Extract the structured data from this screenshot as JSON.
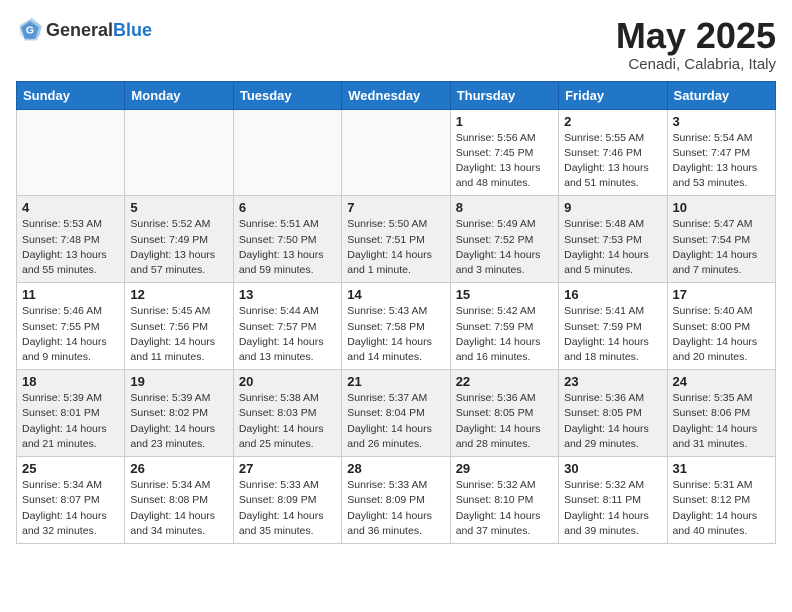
{
  "header": {
    "logo_general": "General",
    "logo_blue": "Blue",
    "month_title": "May 2025",
    "subtitle": "Cenadi, Calabria, Italy"
  },
  "weekdays": [
    "Sunday",
    "Monday",
    "Tuesday",
    "Wednesday",
    "Thursday",
    "Friday",
    "Saturday"
  ],
  "weeks": [
    [
      {
        "day": "",
        "info": ""
      },
      {
        "day": "",
        "info": ""
      },
      {
        "day": "",
        "info": ""
      },
      {
        "day": "",
        "info": ""
      },
      {
        "day": "1",
        "info": "Sunrise: 5:56 AM\nSunset: 7:45 PM\nDaylight: 13 hours\nand 48 minutes."
      },
      {
        "day": "2",
        "info": "Sunrise: 5:55 AM\nSunset: 7:46 PM\nDaylight: 13 hours\nand 51 minutes."
      },
      {
        "day": "3",
        "info": "Sunrise: 5:54 AM\nSunset: 7:47 PM\nDaylight: 13 hours\nand 53 minutes."
      }
    ],
    [
      {
        "day": "4",
        "info": "Sunrise: 5:53 AM\nSunset: 7:48 PM\nDaylight: 13 hours\nand 55 minutes."
      },
      {
        "day": "5",
        "info": "Sunrise: 5:52 AM\nSunset: 7:49 PM\nDaylight: 13 hours\nand 57 minutes."
      },
      {
        "day": "6",
        "info": "Sunrise: 5:51 AM\nSunset: 7:50 PM\nDaylight: 13 hours\nand 59 minutes."
      },
      {
        "day": "7",
        "info": "Sunrise: 5:50 AM\nSunset: 7:51 PM\nDaylight: 14 hours\nand 1 minute."
      },
      {
        "day": "8",
        "info": "Sunrise: 5:49 AM\nSunset: 7:52 PM\nDaylight: 14 hours\nand 3 minutes."
      },
      {
        "day": "9",
        "info": "Sunrise: 5:48 AM\nSunset: 7:53 PM\nDaylight: 14 hours\nand 5 minutes."
      },
      {
        "day": "10",
        "info": "Sunrise: 5:47 AM\nSunset: 7:54 PM\nDaylight: 14 hours\nand 7 minutes."
      }
    ],
    [
      {
        "day": "11",
        "info": "Sunrise: 5:46 AM\nSunset: 7:55 PM\nDaylight: 14 hours\nand 9 minutes."
      },
      {
        "day": "12",
        "info": "Sunrise: 5:45 AM\nSunset: 7:56 PM\nDaylight: 14 hours\nand 11 minutes."
      },
      {
        "day": "13",
        "info": "Sunrise: 5:44 AM\nSunset: 7:57 PM\nDaylight: 14 hours\nand 13 minutes."
      },
      {
        "day": "14",
        "info": "Sunrise: 5:43 AM\nSunset: 7:58 PM\nDaylight: 14 hours\nand 14 minutes."
      },
      {
        "day": "15",
        "info": "Sunrise: 5:42 AM\nSunset: 7:59 PM\nDaylight: 14 hours\nand 16 minutes."
      },
      {
        "day": "16",
        "info": "Sunrise: 5:41 AM\nSunset: 7:59 PM\nDaylight: 14 hours\nand 18 minutes."
      },
      {
        "day": "17",
        "info": "Sunrise: 5:40 AM\nSunset: 8:00 PM\nDaylight: 14 hours\nand 20 minutes."
      }
    ],
    [
      {
        "day": "18",
        "info": "Sunrise: 5:39 AM\nSunset: 8:01 PM\nDaylight: 14 hours\nand 21 minutes."
      },
      {
        "day": "19",
        "info": "Sunrise: 5:39 AM\nSunset: 8:02 PM\nDaylight: 14 hours\nand 23 minutes."
      },
      {
        "day": "20",
        "info": "Sunrise: 5:38 AM\nSunset: 8:03 PM\nDaylight: 14 hours\nand 25 minutes."
      },
      {
        "day": "21",
        "info": "Sunrise: 5:37 AM\nSunset: 8:04 PM\nDaylight: 14 hours\nand 26 minutes."
      },
      {
        "day": "22",
        "info": "Sunrise: 5:36 AM\nSunset: 8:05 PM\nDaylight: 14 hours\nand 28 minutes."
      },
      {
        "day": "23",
        "info": "Sunrise: 5:36 AM\nSunset: 8:05 PM\nDaylight: 14 hours\nand 29 minutes."
      },
      {
        "day": "24",
        "info": "Sunrise: 5:35 AM\nSunset: 8:06 PM\nDaylight: 14 hours\nand 31 minutes."
      }
    ],
    [
      {
        "day": "25",
        "info": "Sunrise: 5:34 AM\nSunset: 8:07 PM\nDaylight: 14 hours\nand 32 minutes."
      },
      {
        "day": "26",
        "info": "Sunrise: 5:34 AM\nSunset: 8:08 PM\nDaylight: 14 hours\nand 34 minutes."
      },
      {
        "day": "27",
        "info": "Sunrise: 5:33 AM\nSunset: 8:09 PM\nDaylight: 14 hours\nand 35 minutes."
      },
      {
        "day": "28",
        "info": "Sunrise: 5:33 AM\nSunset: 8:09 PM\nDaylight: 14 hours\nand 36 minutes."
      },
      {
        "day": "29",
        "info": "Sunrise: 5:32 AM\nSunset: 8:10 PM\nDaylight: 14 hours\nand 37 minutes."
      },
      {
        "day": "30",
        "info": "Sunrise: 5:32 AM\nSunset: 8:11 PM\nDaylight: 14 hours\nand 39 minutes."
      },
      {
        "day": "31",
        "info": "Sunrise: 5:31 AM\nSunset: 8:12 PM\nDaylight: 14 hours\nand 40 minutes."
      }
    ]
  ]
}
